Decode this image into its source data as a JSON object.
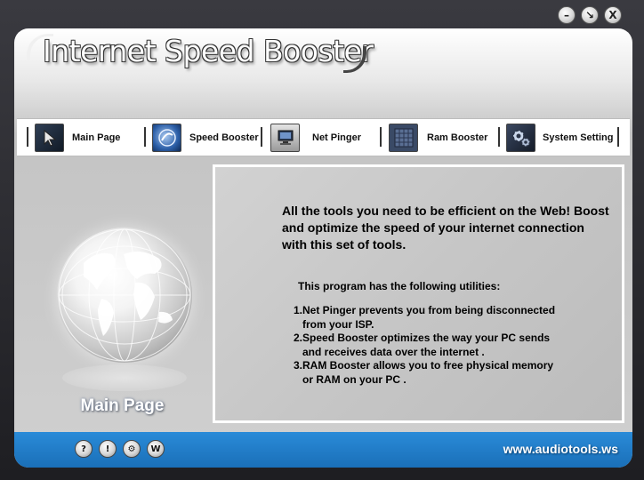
{
  "window": {
    "title": "Internet Speed Booster",
    "controls": [
      {
        "name": "minimize-button",
        "glyph": "–"
      },
      {
        "name": "restore-button",
        "glyph": "↘"
      },
      {
        "name": "close-button",
        "glyph": "X"
      }
    ]
  },
  "toolbar": {
    "items": [
      {
        "label": "Main Page",
        "icon": "main-page-cursor-icon"
      },
      {
        "label": "Speed Booster",
        "icon": "speed-booster-icon"
      },
      {
        "label": "Net Pinger",
        "icon": "net-pinger-monitor-icon"
      },
      {
        "label": "Ram Booster",
        "icon": "ram-booster-chip-icon"
      },
      {
        "label": "System Setting",
        "icon": "system-setting-gears-icon"
      }
    ]
  },
  "left_panel": {
    "caption": "Main Page",
    "image": "globe-icon"
  },
  "content": {
    "headline": "All the tools you need to be efficient on the Web! Boost and optimize the speed of your internet connection with this set of tools.",
    "utilities_title": "This program has the following utilities:",
    "utilities": [
      {
        "first": "1.Net Pinger prevents you from being disconnected",
        "second": "from your ISP."
      },
      {
        "first": "2.Speed Booster optimizes the way your PC sends",
        "second": "and receives data over the internet ."
      },
      {
        "first": "3.RAM Booster allows you to free physical memory",
        "second": "or RAM on your PC ."
      }
    ]
  },
  "footer": {
    "buttons": [
      {
        "glyph": "?",
        "name": "help-icon"
      },
      {
        "glyph": "!",
        "name": "info-icon"
      },
      {
        "glyph": "⚙",
        "name": "settings-icon"
      },
      {
        "glyph": "W",
        "name": "web-icon"
      }
    ],
    "website": "www.audiotools.ws"
  },
  "colors": {
    "footer_blue": "#1f7bc9",
    "panel_gray": "#c8c8c8",
    "frame_dark": "#2a2a2e"
  }
}
